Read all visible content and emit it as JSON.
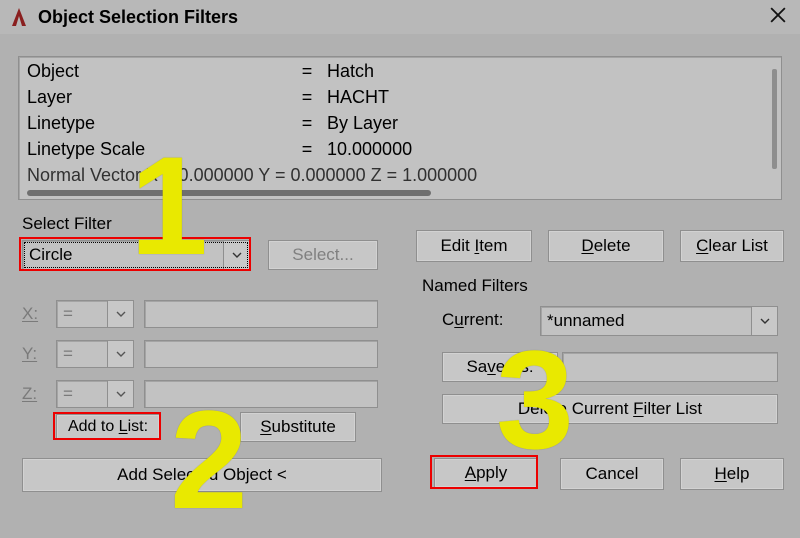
{
  "window": {
    "title": "Object Selection Filters"
  },
  "filter_list": {
    "rows": [
      {
        "prop": "Object",
        "eq": "=",
        "value": "Hatch"
      },
      {
        "prop": "Layer",
        "eq": "=",
        "value": "HACHT"
      },
      {
        "prop": "Linetype",
        "eq": "=",
        "value": "By Layer"
      },
      {
        "prop": "Linetype Scale",
        "eq": "=",
        "value": "10.000000"
      }
    ],
    "partial_row": "Normal Vector             X =  0.000000     Y = 0.000000     Z = 1.000000"
  },
  "select_filter": {
    "label": "Select Filter",
    "type_value": "Circle",
    "select_button": "Select...",
    "xyz": {
      "x_label": "X:",
      "y_label": "Y:",
      "z_label": "Z:",
      "op": "="
    },
    "add_to_list": "Add to List:",
    "substitute": "Substitute",
    "add_selected": "Add Selected Object <"
  },
  "right": {
    "edit_item": "Edit Item",
    "delete": "Delete",
    "clear_list": "Clear List",
    "named_filters": "Named Filters",
    "current_label": "Current:",
    "current_value": "*unnamed",
    "save_as": "Save As:",
    "save_as_value": "",
    "delete_filter_list": "Delete Current Filter List"
  },
  "bottom": {
    "apply": "Apply",
    "cancel": "Cancel",
    "help": "Help"
  },
  "annotations": {
    "n1": "1",
    "n2": "2",
    "n3": "3"
  }
}
